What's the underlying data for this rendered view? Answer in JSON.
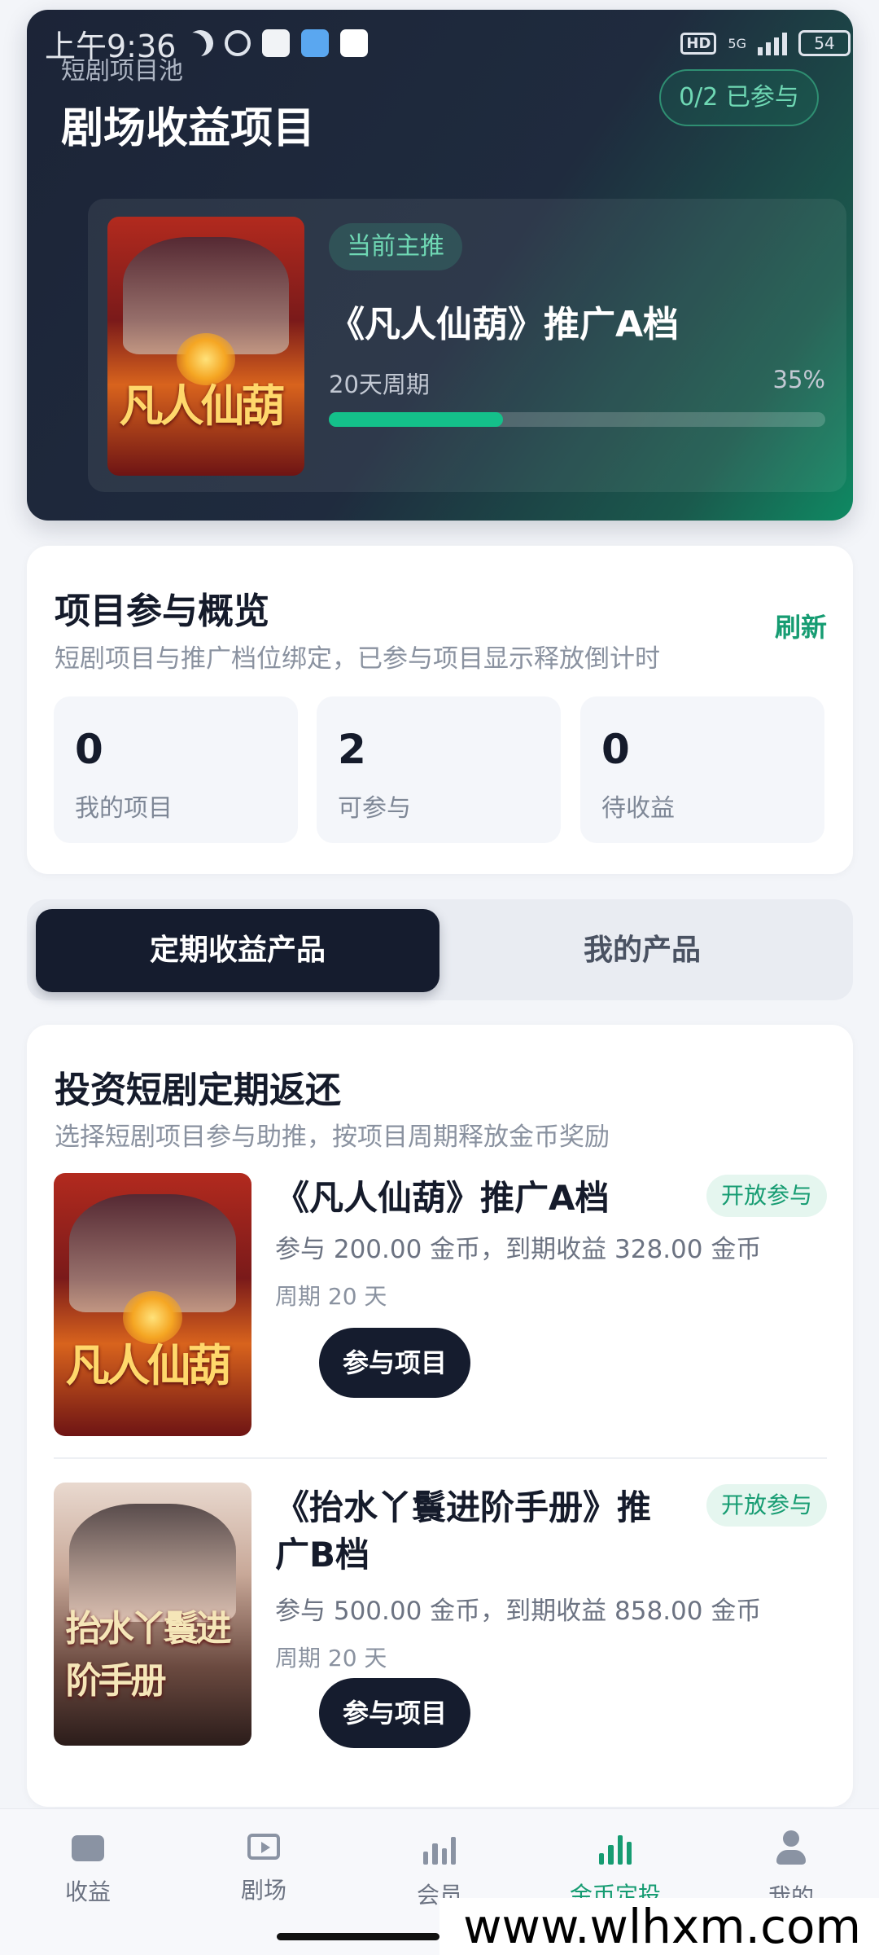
{
  "status_bar": {
    "time": "上午9:36",
    "network": "5G",
    "hd": "HD",
    "battery": "54",
    "icons": [
      "moon-icon",
      "alarm-icon",
      "app-notification-icon",
      "app-notification-icon",
      "app-notification-icon"
    ]
  },
  "hero": {
    "subtitle": "短剧项目池",
    "title": "剧场收益项目",
    "participation_badge": "0/2 已参与",
    "current_tag": "当前主推",
    "project_title": "《凡人仙葫》推广A档",
    "period": "20天周期",
    "progress_text": "35%",
    "progress_value": 0.35
  },
  "overview": {
    "title": "项目参与概览",
    "subtitle": "短剧项目与推广档位绑定，已参与项目显示释放倒计时",
    "refresh_label": "刷新",
    "stats": [
      {
        "value": "0",
        "label": "我的项目"
      },
      {
        "value": "2",
        "label": "可参与"
      },
      {
        "value": "0",
        "label": "待收益"
      }
    ]
  },
  "tabs": [
    {
      "label": "定期收益产品",
      "active": true
    },
    {
      "label": "我的产品",
      "active": false
    }
  ],
  "products": {
    "title": "投资短剧定期返还",
    "subtitle": "选择短剧项目参与助推，按项目周期释放金币奖励",
    "items": [
      {
        "title": "《凡人仙葫》推广A档",
        "badge": "开放参与",
        "desc": "参与 200.00 金币，到期收益 328.00 金币",
        "period": "周期 20 天",
        "button": "参与项目",
        "poster_text": "凡人仙葫"
      },
      {
        "title": "《抬水丫鬟进阶手册》推广B档",
        "badge": "开放参与",
        "desc": "参与 500.00 金币，到期收益 858.00 金币",
        "period": "周期 20 天",
        "button": "参与项目",
        "poster_text": "抬水丫鬟进阶手册"
      }
    ]
  },
  "bottom_nav": [
    {
      "label": "收益",
      "icon": "wallet-icon",
      "active": false
    },
    {
      "label": "剧场",
      "icon": "play-icon",
      "active": false
    },
    {
      "label": "会员",
      "icon": "chart-icon",
      "active": false
    },
    {
      "label": "金币定投",
      "icon": "bar-chart-icon",
      "active": true
    },
    {
      "label": "我的",
      "icon": "user-icon",
      "active": false
    }
  ],
  "watermark": "www.wlhxm.com",
  "colors": {
    "accent": "#169c72",
    "progress": "#14c08a",
    "dark": "#151c2e"
  }
}
